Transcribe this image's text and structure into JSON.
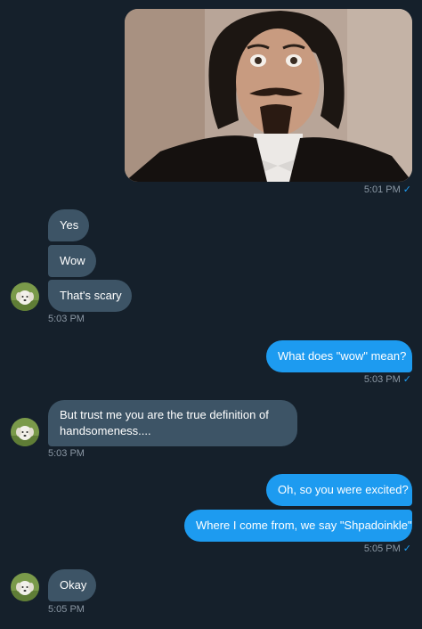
{
  "messages": {
    "image_time": "5:01 PM",
    "yes": "Yes",
    "wow": "Wow",
    "scary": "That's scary",
    "time_1": "5:03 PM",
    "what_wow": "What does \"wow\" mean?",
    "time_2": "5:03 PM",
    "handsome": "But trust me you are the true definition of handsomeness....",
    "time_3": "5:03 PM",
    "excited": "Oh, so you were excited?",
    "shpadoinkle": "Where I come from, we say \"Shpadoinkle\"",
    "time_4": "5:05 PM",
    "okay": "Okay",
    "time_5": "5:05 PM"
  },
  "icons": {
    "read_receipt": "checkmark-icon",
    "avatar": "puppy-avatar"
  },
  "colors": {
    "background": "#15202b",
    "incoming_bubble": "#3d5466",
    "outgoing_bubble": "#1d9bf0",
    "meta_text": "#8b98a5"
  }
}
